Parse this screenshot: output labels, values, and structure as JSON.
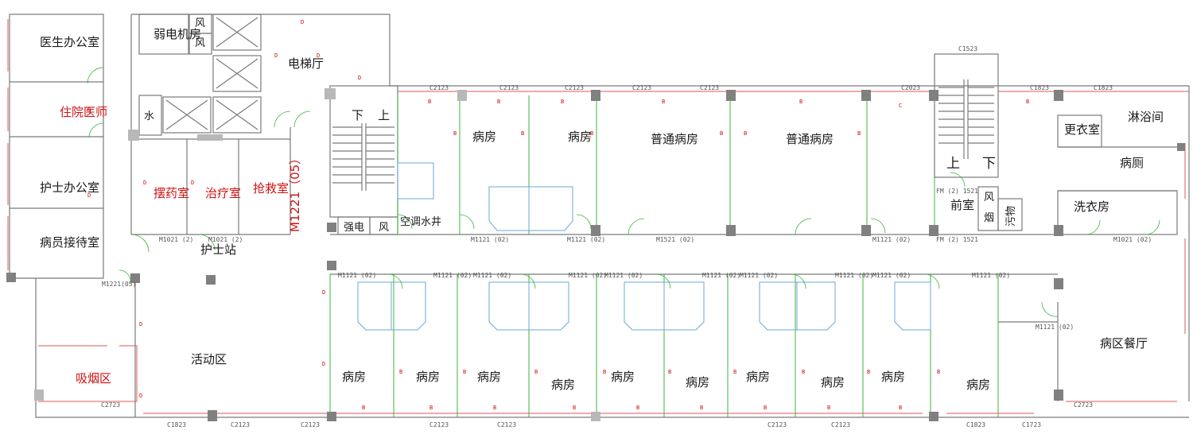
{
  "rooms": {
    "doctor_office": "医生办公室",
    "resident_doctor": "住院医师",
    "nurse_office": "护士办公室",
    "reception": "病员接待室",
    "weak_electric": "弱电机房",
    "wind_1": "风",
    "wind_2": "风",
    "water": "水",
    "elevator_hall": "电梯厅",
    "dispensary": "摆药室",
    "treatment": "治疗室",
    "rescue": "抢救室",
    "rescue_door": "M1221（05）",
    "nurse_station": "护士站",
    "activity": "活动区",
    "smoking": "吸烟区",
    "stair_down_1": "下",
    "stair_up_1": "上",
    "strong_elec": "强电",
    "wind_3": "风",
    "ac_shaft": "空调水井",
    "ward_1": "病房",
    "ward_2": "病房",
    "general_ward_1": "普通病房",
    "general_ward_2": "普通病房",
    "stair_up_2": "上",
    "stair_down_2": "下",
    "anteroom": "前室",
    "wind_4": "风",
    "smoke": "烟",
    "dirty": "污物",
    "changing": "更衣室",
    "shower": "淋浴间",
    "ward_toilet": "病厕",
    "laundry": "洗衣房",
    "ward_dining": "病区餐厅",
    "ward_b1": "病房",
    "ward_b2": "病房",
    "ward_b3": "病房",
    "ward_b4": "病房",
    "ward_b5": "病房",
    "ward_b6": "病房",
    "ward_b7": "病房",
    "ward_b8": "病房",
    "ward_b9": "病房",
    "ward_b10": "病房"
  },
  "tags": {
    "c2123_a": "C2123",
    "c2123_b": "C2123",
    "c2123_c": "C2123",
    "c2123_d": "C2123",
    "c2123_e": "C2123",
    "c2023": "C2023",
    "c1823_a": "C1823",
    "c1823_b": "C1823",
    "c1523": "C1523",
    "c2723_a": "C2723",
    "c2723_b": "C2723",
    "c1723": "C1723",
    "c1823_bot": "C1823",
    "c2123_bot_a": "C2123",
    "c2123_bot_b": "C2123",
    "c2123_bot_c": "C2123",
    "c2123_bot_d": "C2123",
    "c1823_bot_b": "C1823",
    "c2123_bot_e": "C2123",
    "c2123_bot_f": "C2123",
    "m1021_a": "M1021 (2)",
    "m1021_b": "M1021 (2)",
    "m1221_05": "M1221(05)",
    "m1121_a": "M1121 (02)",
    "m1121_b": "M1121 (02)",
    "m1521_a": "M1521 (02)",
    "m1121_c": "M1121 (02)",
    "fm1521_a": "FM (2) 1521",
    "fm1521_b": "FM (2) 1521",
    "m1021_c": "M1021 (02)",
    "m1121_d": "M1121 (02)",
    "m1121_r1": "M1121 (02)",
    "m1121_r2": "M1121 (02)",
    "m1121_r3": "M1121 (02)",
    "m1121_r4": "M1121 (02)",
    "m1121_r5": "M1121 (02)",
    "m1121_r6": "M1121 (02)",
    "m1121_r7": "M1121 (02)",
    "m1121_r8": "M1121 (02)",
    "m1121_r9": "M1121 (02)",
    "m1121_r10": "M1121 (02)"
  }
}
